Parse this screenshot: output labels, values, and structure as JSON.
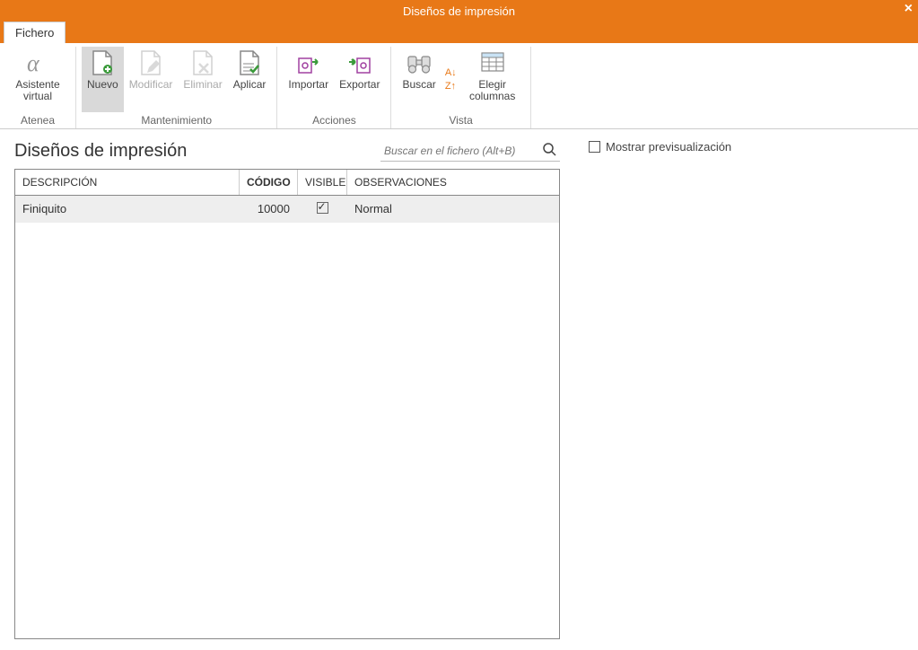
{
  "window": {
    "title": "Diseños de impresión"
  },
  "tabs": {
    "fichero": "Fichero"
  },
  "ribbon": {
    "groups": {
      "atenea": {
        "label": "Atenea",
        "asistente": "Asistente virtual"
      },
      "mantenimiento": {
        "label": "Mantenimiento",
        "nuevo": "Nuevo",
        "modificar": "Modificar",
        "eliminar": "Eliminar",
        "aplicar": "Aplicar"
      },
      "acciones": {
        "label": "Acciones",
        "importar": "Importar",
        "exportar": "Exportar"
      },
      "vista": {
        "label": "Vista",
        "buscar": "Buscar",
        "elegir": "Elegir columnas"
      }
    }
  },
  "page": {
    "title": "Diseños de impresión",
    "search_placeholder": "Buscar en el fichero (Alt+B)"
  },
  "table": {
    "columns": {
      "descripcion": "DESCRIPCIÓN",
      "codigo": "CÓDIGO",
      "visible": "VISIBLE",
      "observaciones": "OBSERVACIONES"
    },
    "rows": [
      {
        "descripcion": "Finiquito",
        "codigo": "10000",
        "visible": true,
        "observaciones": "Normal"
      }
    ]
  },
  "preview": {
    "label": "Mostrar previsualización",
    "checked": false
  }
}
